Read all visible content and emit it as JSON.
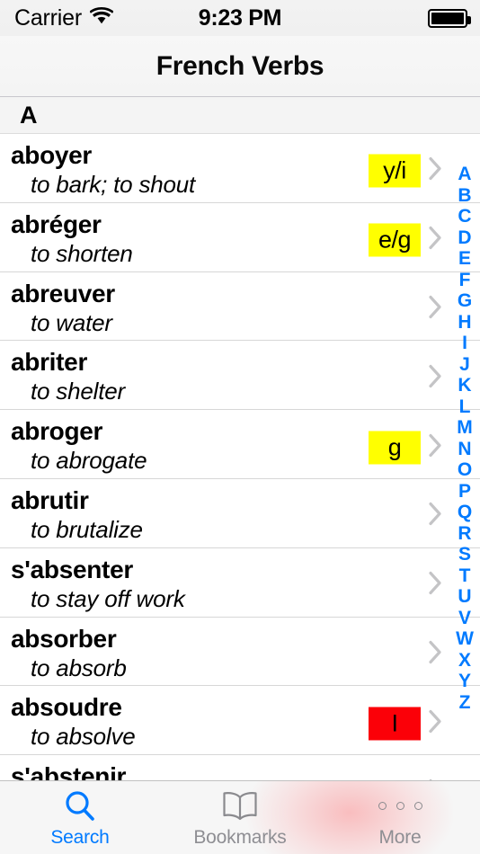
{
  "status_bar": {
    "carrier": "Carrier",
    "wifi_icon": "wifi-icon",
    "time": "9:23 PM",
    "battery_icon": "battery-full-icon"
  },
  "nav_bar": {
    "title": "French Verbs"
  },
  "list": {
    "section_header": "A",
    "rows": [
      {
        "word": "aboyer",
        "definition": "to bark; to shout",
        "badge": "y/i",
        "badge_color": "#ffff00",
        "badge_kind": "yellow",
        "chevron": "chevron-right-icon"
      },
      {
        "word": "abréger",
        "definition": "to shorten",
        "badge": "e/g",
        "badge_color": "#ffff00",
        "badge_kind": "yellow",
        "chevron": "chevron-right-icon"
      },
      {
        "word": "abreuver",
        "definition": "to water",
        "badge": "",
        "badge_color": "",
        "badge_kind": "none",
        "chevron": "chevron-right-icon"
      },
      {
        "word": "abriter",
        "definition": "to shelter",
        "badge": "",
        "badge_color": "",
        "badge_kind": "none",
        "chevron": "chevron-right-icon"
      },
      {
        "word": "abroger",
        "definition": "to abrogate",
        "badge": "g",
        "badge_color": "#ffff00",
        "badge_kind": "yellow",
        "chevron": "chevron-right-icon"
      },
      {
        "word": "abrutir",
        "definition": "to brutalize",
        "badge": "",
        "badge_color": "",
        "badge_kind": "none",
        "chevron": "chevron-right-icon"
      },
      {
        "word": "s'absenter",
        "definition": "to stay off work",
        "badge": "",
        "badge_color": "",
        "badge_kind": "none",
        "chevron": "chevron-right-icon"
      },
      {
        "word": "absorber",
        "definition": "to absorb",
        "badge": "",
        "badge_color": "",
        "badge_kind": "none",
        "chevron": "chevron-right-icon"
      },
      {
        "word": "absoudre",
        "definition": "to absolve",
        "badge": "I",
        "badge_color": "#fb0008",
        "badge_kind": "red",
        "chevron": "chevron-right-icon"
      },
      {
        "word": "s'abstenir",
        "definition": "",
        "badge": "",
        "badge_color": "",
        "badge_kind": "none",
        "chevron": "chevron-right-icon"
      }
    ]
  },
  "index_bar": {
    "accent_color": "#007aff",
    "letters": [
      "A",
      "B",
      "C",
      "D",
      "E",
      "F",
      "G",
      "H",
      "I",
      "J",
      "K",
      "L",
      "M",
      "N",
      "O",
      "P",
      "Q",
      "R",
      "S",
      "T",
      "U",
      "V",
      "W",
      "X",
      "Y",
      "Z"
    ]
  },
  "tab_bar": {
    "active_color": "#007aff",
    "inactive_color": "#8e8e93",
    "tabs": [
      {
        "label": "Search",
        "icon": "search-icon",
        "active": true
      },
      {
        "label": "Bookmarks",
        "icon": "book-icon",
        "active": false
      },
      {
        "label": "More",
        "icon": "ellipsis-icon",
        "active": false
      }
    ]
  }
}
